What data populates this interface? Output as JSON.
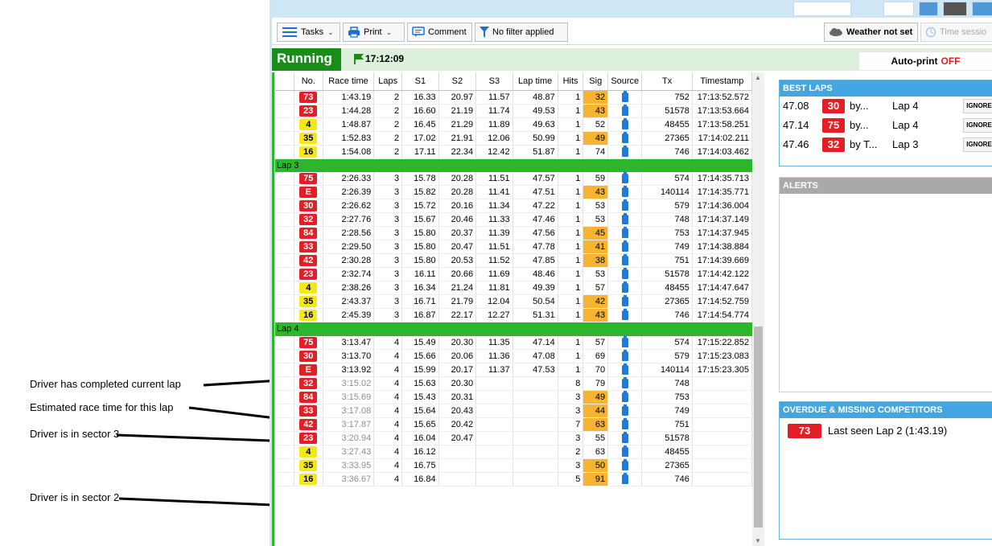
{
  "annotations": [
    {
      "text": "Driver has completed current lap"
    },
    {
      "text": "Estimated race time for this lap"
    },
    {
      "text": "Driver is in sector 3"
    },
    {
      "text": "Driver is in sector 2"
    }
  ],
  "toolbar": {
    "tasks_label": "Tasks",
    "print_label": "Print",
    "comment_label": "Comment",
    "filter_label": "No filter applied",
    "weather_label": "Weather not set",
    "time_session_label": "Time sessio"
  },
  "status": {
    "state": "Running",
    "clock": "17:12:09",
    "autoprint_label": "Auto-print",
    "autoprint_value": "OFF"
  },
  "colors": {
    "running_green": "#1a8c1a",
    "group_green": "#2db52d",
    "badge_red": "#e21f26",
    "badge_yellow": "#f5e81a",
    "signal_orange": "#f7b432",
    "panel_blue": "#43a6e0",
    "autoprint_off_red": "#e41a1a"
  },
  "grid": {
    "columns": [
      "No.",
      "Race time",
      "Laps",
      "S1",
      "S2",
      "S3",
      "Lap time",
      "Hits",
      "Sig",
      "Source",
      "Tx",
      "Timestamp"
    ],
    "rows": [
      {
        "type": "row",
        "no": "73",
        "badge": "red",
        "race_time": "1:43.19",
        "laps": "2",
        "s1": "16.33",
        "s2": "20.97",
        "s3": "11.57",
        "lap_time": "48.87",
        "hits": "1",
        "sig": "32",
        "sig_warn": true,
        "tx": "752",
        "timestamp": "17:13:52.572"
      },
      {
        "type": "row",
        "no": "23",
        "badge": "red",
        "race_time": "1:44.28",
        "laps": "2",
        "s1": "16.60",
        "s2": "21.19",
        "s3": "11.74",
        "lap_time": "49.53",
        "hits": "1",
        "sig": "43",
        "sig_warn": true,
        "tx": "51578",
        "timestamp": "17:13:53.664"
      },
      {
        "type": "row",
        "no": "4",
        "badge": "yellow",
        "race_time": "1:48.87",
        "laps": "2",
        "s1": "16.45",
        "s2": "21.29",
        "s3": "11.89",
        "lap_time": "49.63",
        "hits": "1",
        "sig": "52",
        "sig_warn": false,
        "tx": "48455",
        "timestamp": "17:13:58.251"
      },
      {
        "type": "row",
        "no": "35",
        "badge": "yellow",
        "race_time": "1:52.83",
        "laps": "2",
        "s1": "17.02",
        "s2": "21.91",
        "s3": "12.06",
        "lap_time": "50.99",
        "hits": "1",
        "sig": "49",
        "sig_warn": true,
        "tx": "27365",
        "timestamp": "17:14:02.211"
      },
      {
        "type": "row",
        "no": "16",
        "badge": "yellow",
        "race_time": "1:54.08",
        "laps": "2",
        "s1": "17.11",
        "s2": "22.34",
        "s3": "12.42",
        "lap_time": "51.87",
        "hits": "1",
        "sig": "74",
        "sig_warn": false,
        "tx": "746",
        "timestamp": "17:14:03.462"
      },
      {
        "type": "group",
        "label": "Lap 3"
      },
      {
        "type": "row",
        "no": "75",
        "badge": "red",
        "race_time": "2:26.33",
        "laps": "3",
        "s1": "15.78",
        "s2": "20.28",
        "s3": "11.51",
        "lap_time": "47.57",
        "hits": "1",
        "sig": "59",
        "sig_warn": false,
        "tx": "574",
        "timestamp": "17:14:35.713"
      },
      {
        "type": "row",
        "no": "E",
        "badge": "red",
        "race_time": "2:26.39",
        "laps": "3",
        "s1": "15.82",
        "s2": "20.28",
        "s3": "11.41",
        "lap_time": "47.51",
        "hits": "1",
        "sig": "43",
        "sig_warn": true,
        "tx": "140114",
        "timestamp": "17:14:35.771"
      },
      {
        "type": "row",
        "no": "30",
        "badge": "red",
        "race_time": "2:26.62",
        "laps": "3",
        "s1": "15.72",
        "s2": "20.16",
        "s3": "11.34",
        "lap_time": "47.22",
        "hits": "1",
        "sig": "53",
        "sig_warn": false,
        "tx": "579",
        "timestamp": "17:14:36.004"
      },
      {
        "type": "row",
        "no": "32",
        "badge": "red",
        "race_time": "2:27.76",
        "laps": "3",
        "s1": "15.67",
        "s2": "20.46",
        "s3": "11.33",
        "lap_time": "47.46",
        "hits": "1",
        "sig": "53",
        "sig_warn": false,
        "tx": "748",
        "timestamp": "17:14:37.149"
      },
      {
        "type": "row",
        "no": "84",
        "badge": "red",
        "race_time": "2:28.56",
        "laps": "3",
        "s1": "15.80",
        "s2": "20.37",
        "s3": "11.39",
        "lap_time": "47.56",
        "hits": "1",
        "sig": "45",
        "sig_warn": true,
        "tx": "753",
        "timestamp": "17:14:37.945"
      },
      {
        "type": "row",
        "no": "33",
        "badge": "red",
        "race_time": "2:29.50",
        "laps": "3",
        "s1": "15.80",
        "s2": "20.47",
        "s3": "11.51",
        "lap_time": "47.78",
        "hits": "1",
        "sig": "41",
        "sig_warn": true,
        "tx": "749",
        "timestamp": "17:14:38.884"
      },
      {
        "type": "row",
        "no": "42",
        "badge": "red",
        "race_time": "2:30.28",
        "laps": "3",
        "s1": "15.80",
        "s2": "20.53",
        "s3": "11.52",
        "lap_time": "47.85",
        "hits": "1",
        "sig": "38",
        "sig_warn": true,
        "tx": "751",
        "timestamp": "17:14:39.669"
      },
      {
        "type": "row",
        "no": "23",
        "badge": "red",
        "race_time": "2:32.74",
        "laps": "3",
        "s1": "16.11",
        "s2": "20.66",
        "s3": "11.69",
        "lap_time": "48.46",
        "hits": "1",
        "sig": "53",
        "sig_warn": false,
        "tx": "51578",
        "timestamp": "17:14:42.122"
      },
      {
        "type": "row",
        "no": "4",
        "badge": "yellow",
        "race_time": "2:38.26",
        "laps": "3",
        "s1": "16.34",
        "s2": "21.24",
        "s3": "11.81",
        "lap_time": "49.39",
        "hits": "1",
        "sig": "57",
        "sig_warn": false,
        "tx": "48455",
        "timestamp": "17:14:47.647"
      },
      {
        "type": "row",
        "no": "35",
        "badge": "yellow",
        "race_time": "2:43.37",
        "laps": "3",
        "s1": "16.71",
        "s2": "21.79",
        "s3": "12.04",
        "lap_time": "50.54",
        "hits": "1",
        "sig": "42",
        "sig_warn": true,
        "tx": "27365",
        "timestamp": "17:14:52.759"
      },
      {
        "type": "row",
        "no": "16",
        "badge": "yellow",
        "race_time": "2:45.39",
        "laps": "3",
        "s1": "16.87",
        "s2": "22.17",
        "s3": "12.27",
        "lap_time": "51.31",
        "hits": "1",
        "sig": "43",
        "sig_warn": true,
        "tx": "746",
        "timestamp": "17:14:54.774"
      },
      {
        "type": "group",
        "label": "Lap 4"
      },
      {
        "type": "row",
        "no": "75",
        "badge": "red",
        "race_time": "3:13.47",
        "laps": "4",
        "s1": "15.49",
        "s2": "20.30",
        "s3": "11.35",
        "lap_time": "47.14",
        "hits": "1",
        "sig": "57",
        "sig_warn": false,
        "tx": "574",
        "timestamp": "17:15:22.852"
      },
      {
        "type": "row",
        "no": "30",
        "badge": "red",
        "race_time": "3:13.70",
        "laps": "4",
        "s1": "15.66",
        "s2": "20.06",
        "s3": "11.36",
        "lap_time": "47.08",
        "hits": "1",
        "sig": "69",
        "sig_warn": false,
        "tx": "579",
        "timestamp": "17:15:23.083"
      },
      {
        "type": "row",
        "no": "E",
        "badge": "red",
        "race_time": "3:13.92",
        "laps": "4",
        "s1": "15.99",
        "s2": "20.17",
        "s3": "11.37",
        "lap_time": "47.53",
        "hits": "1",
        "sig": "70",
        "sig_warn": false,
        "tx": "140114",
        "timestamp": "17:15:23.305"
      },
      {
        "type": "row",
        "no": "32",
        "badge": "red",
        "race_time": "3:15.02",
        "estimated": true,
        "laps": "4",
        "s1": "15.63",
        "s2": "20.30",
        "s3": "",
        "lap_time": "",
        "hits": "8",
        "sig": "79",
        "sig_warn": false,
        "tx": "748",
        "timestamp": ""
      },
      {
        "type": "row",
        "no": "84",
        "badge": "red",
        "race_time": "3:15.69",
        "estimated": true,
        "laps": "4",
        "s1": "15.43",
        "s2": "20.31",
        "s3": "",
        "lap_time": "",
        "hits": "3",
        "sig": "49",
        "sig_warn": true,
        "tx": "753",
        "timestamp": ""
      },
      {
        "type": "row",
        "no": "33",
        "badge": "red",
        "race_time": "3:17.08",
        "estimated": true,
        "laps": "4",
        "s1": "15.64",
        "s2": "20.43",
        "s3": "",
        "lap_time": "",
        "hits": "3",
        "sig": "44",
        "sig_warn": true,
        "tx": "749",
        "timestamp": ""
      },
      {
        "type": "row",
        "no": "42",
        "badge": "red",
        "race_time": "3:17.87",
        "estimated": true,
        "laps": "4",
        "s1": "15.65",
        "s2": "20.42",
        "s3": "",
        "lap_time": "",
        "hits": "7",
        "sig": "63",
        "sig_warn": true,
        "tx": "751",
        "timestamp": ""
      },
      {
        "type": "row",
        "no": "23",
        "badge": "red",
        "race_time": "3:20.94",
        "estimated": true,
        "laps": "4",
        "s1": "16.04",
        "s2": "20.47",
        "s3": "",
        "lap_time": "",
        "hits": "3",
        "sig": "55",
        "sig_warn": false,
        "tx": "51578",
        "timestamp": ""
      },
      {
        "type": "row",
        "no": "4",
        "badge": "yellow",
        "race_time": "3:27.43",
        "estimated": true,
        "laps": "4",
        "s1": "16.12",
        "s2": "",
        "s3": "",
        "lap_time": "",
        "hits": "2",
        "sig": "63",
        "sig_warn": false,
        "tx": "48455",
        "timestamp": ""
      },
      {
        "type": "row",
        "no": "35",
        "badge": "yellow",
        "race_time": "3:33.95",
        "estimated": true,
        "laps": "4",
        "s1": "16.75",
        "s2": "",
        "s3": "",
        "lap_time": "",
        "hits": "3",
        "sig": "50",
        "sig_warn": true,
        "tx": "27365",
        "timestamp": ""
      },
      {
        "type": "row",
        "no": "16",
        "badge": "yellow",
        "race_time": "3:36.67",
        "estimated": true,
        "laps": "4",
        "s1": "16.84",
        "s2": "",
        "s3": "",
        "lap_time": "",
        "hits": "5",
        "sig": "91",
        "sig_warn": true,
        "tx": "746",
        "timestamp": ""
      }
    ]
  },
  "best_laps": {
    "title": "BEST LAPS",
    "ignore_label": "IGNORE",
    "items": [
      {
        "time": "47.08",
        "no": "30",
        "by": "by...",
        "lap": "Lap 4"
      },
      {
        "time": "47.14",
        "no": "75",
        "by": "by...",
        "lap": "Lap 4"
      },
      {
        "time": "47.46",
        "no": "32",
        "by": "by T...",
        "lap": "Lap 3"
      }
    ]
  },
  "alerts": {
    "title": "ALERTS"
  },
  "overdue": {
    "title": "OVERDUE & MISSING COMPETITORS",
    "items": [
      {
        "no": "73",
        "text": "Last seen Lap 2 (1:43.19)"
      }
    ]
  }
}
